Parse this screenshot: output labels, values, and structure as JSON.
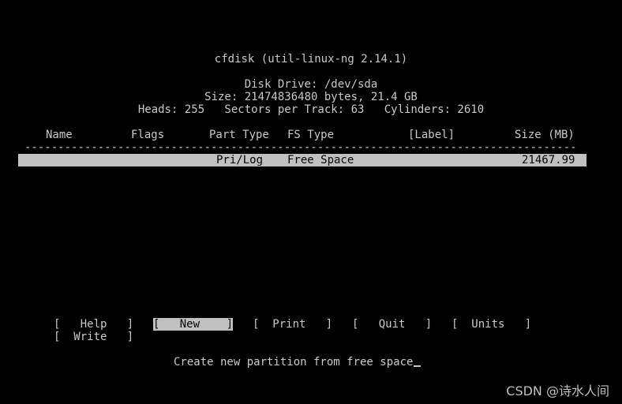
{
  "app": {
    "title": "cfdisk (util-linux-ng 2.14.1)"
  },
  "disk": {
    "drive": "Disk Drive: /dev/sda",
    "size": "Size: 21474836480 bytes, 21.4 GB",
    "geometry": "Heads: 255   Sectors per Track: 63   Cylinders: 2610"
  },
  "table": {
    "columns": {
      "name": "Name",
      "flags": "Flags",
      "part_type": "Part Type",
      "fs_type": "FS Type",
      "label": "[Label]",
      "size": "Size (MB)"
    },
    "rows": [
      {
        "name": "",
        "flags": "",
        "part_type": "Pri/Log",
        "fs_type": "Free Space",
        "label": "",
        "size": "21467.99",
        "selected": true
      }
    ]
  },
  "menu": {
    "items": [
      {
        "label": "[   Help   ]",
        "active": false
      },
      {
        "label": "[   New    ]",
        "active": true
      },
      {
        "label": "[  Print   ]",
        "active": false
      },
      {
        "label": "[   Quit   ]",
        "active": false
      },
      {
        "label": "[  Units   ]",
        "active": false
      },
      {
        "label": "[  Write   ]",
        "active": false
      }
    ]
  },
  "status": {
    "message": "Create new partition from free space"
  },
  "watermark": {
    "text": "CSDN @诗水人间"
  }
}
